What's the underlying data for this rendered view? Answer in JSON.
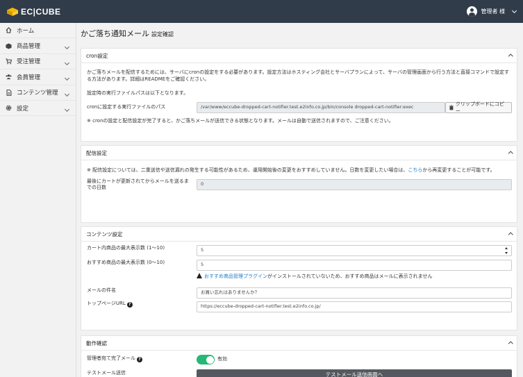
{
  "header": {
    "logo_text": "EC|CUBE",
    "user_name": "管理者 様"
  },
  "sidebar": {
    "items": [
      {
        "label": "ホーム",
        "icon": "home-icon",
        "has_arrow": false
      },
      {
        "label": "商品管理",
        "icon": "cube-icon",
        "has_arrow": true
      },
      {
        "label": "受注管理",
        "icon": "cart-icon",
        "has_arrow": true
      },
      {
        "label": "会員管理",
        "icon": "users-icon",
        "has_arrow": true
      },
      {
        "label": "コンテンツ管理",
        "icon": "file-icon",
        "has_arrow": true
      },
      {
        "label": "設定",
        "icon": "gear-icon",
        "has_arrow": true
      }
    ]
  },
  "page": {
    "title": "かご落ち通知メール",
    "subtitle": "設定確認"
  },
  "cron": {
    "heading": "cron設定",
    "desc1": "かご落ちメールを配信するためには、サーバにcronの設定をする必要があります。設定方法はホスティング会社とサーバプランによって、サーバの管理画面から行う方法と直接コマンドで設定する方法があります。詳細はREADMEをご確認ください。",
    "desc2": "設定時の実行ファイルパスは以下となります。",
    "path_label": "cronに設定する実行ファイルのパス",
    "path_value": "/var/www/eccube-dropped-cart-notifier.test.e2info.co.jp/bin/console dropped-cart-notifier:exec",
    "copy_label": "クリップボードにコピー",
    "note": "※ cronの設定と配信設定が完了すると、かご落ちメールが送信できる状態となります。メールは自動で送信されますので、ご注意ください。"
  },
  "delivery": {
    "heading": "配信設定",
    "note_prefix": "※ 配信設定については、二重送信や送信漏れの発生する可能性があるため、運用開始後の変更をおすすめしていません。日数を変更したい場合は、",
    "note_link": "こちら",
    "note_suffix": "から再変更することが可能です。",
    "days_label": "最後にカートが更新されてからメールを送るまでの日数",
    "days_value": "0"
  },
  "content": {
    "heading": "コンテンツ設定",
    "cart_max_label": "カート内商品の最大表示数 (1〜10)",
    "cart_max_value": "5",
    "rec_max_label": "おすすめ商品の最大表示数 (0〜10)",
    "rec_max_value": "5",
    "warn_link": "おすすめ商品管理プラグイン",
    "warn_text": "がインストールされていないため、おすすめ商品はメールに表示されません",
    "subject_label": "メールの件名",
    "subject_value": "お買い忘れはありませんか？",
    "top_url_label": "トップページURL",
    "top_url_value": "https://eccube-dropped-cart-notifier.test.e2info.co.jp/"
  },
  "operation": {
    "heading": "動作確認",
    "admin_mail_label": "管理者宛て完了メール",
    "toggle_state": "有効",
    "test_mail_label": "テストメール送信",
    "test_button": "テストメール送信画面へ"
  },
  "colors": {
    "topbar": "#313c4a",
    "toggle_on": "#25b877",
    "link": "#1e7ac7",
    "dark_button": "#54595f"
  }
}
